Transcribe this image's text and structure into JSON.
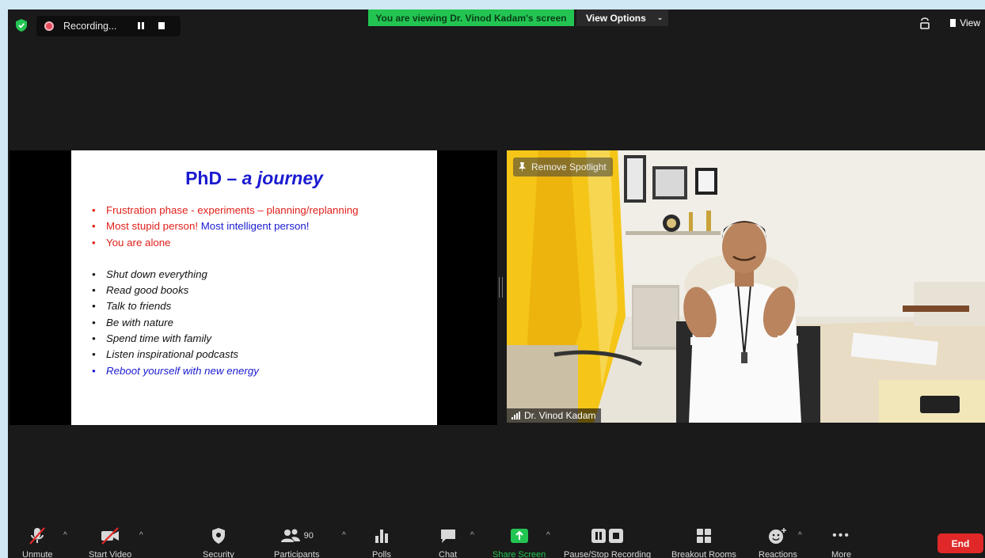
{
  "recording": {
    "label": "Recording..."
  },
  "banner": {
    "viewing_text": "You are viewing Dr. Vinod Kadam's screen",
    "view_options": "View Options"
  },
  "top_right": {
    "view_label": "View"
  },
  "slide": {
    "title_main": "PhD – ",
    "title_italic": "a journey",
    "red_bullets": [
      "Frustration phase -  experiments – planning/replanning",
      "Most stupid person! ",
      "You are alone"
    ],
    "red_bullet_2_blue_suffix": "Most intelligent person!",
    "italic_bullets": [
      "Shut down everything",
      "Read good books",
      "Talk to friends",
      "Be with nature",
      "Spend time with family",
      "Listen inspirational podcasts"
    ],
    "blue_bullet": "Reboot yourself with new energy"
  },
  "video": {
    "remove_spotlight": "Remove Spotlight",
    "participant_name": "Dr. Vinod Kadam"
  },
  "toolbar": {
    "unmute": "Unmute",
    "start_video": "Start Video",
    "security": "Security",
    "participants": "Participants",
    "participants_count": "90",
    "polls": "Polls",
    "chat": "Chat",
    "share_screen": "Share Screen",
    "pause_stop_recording": "Pause/Stop Recording",
    "breakout_rooms": "Breakout Rooms",
    "reactions": "Reactions",
    "more": "More",
    "end": "End"
  },
  "colors": {
    "accent_green": "#23c552",
    "end_red": "#e02828",
    "slide_blue": "#1a1ad1",
    "slide_red": "#e0201a"
  }
}
